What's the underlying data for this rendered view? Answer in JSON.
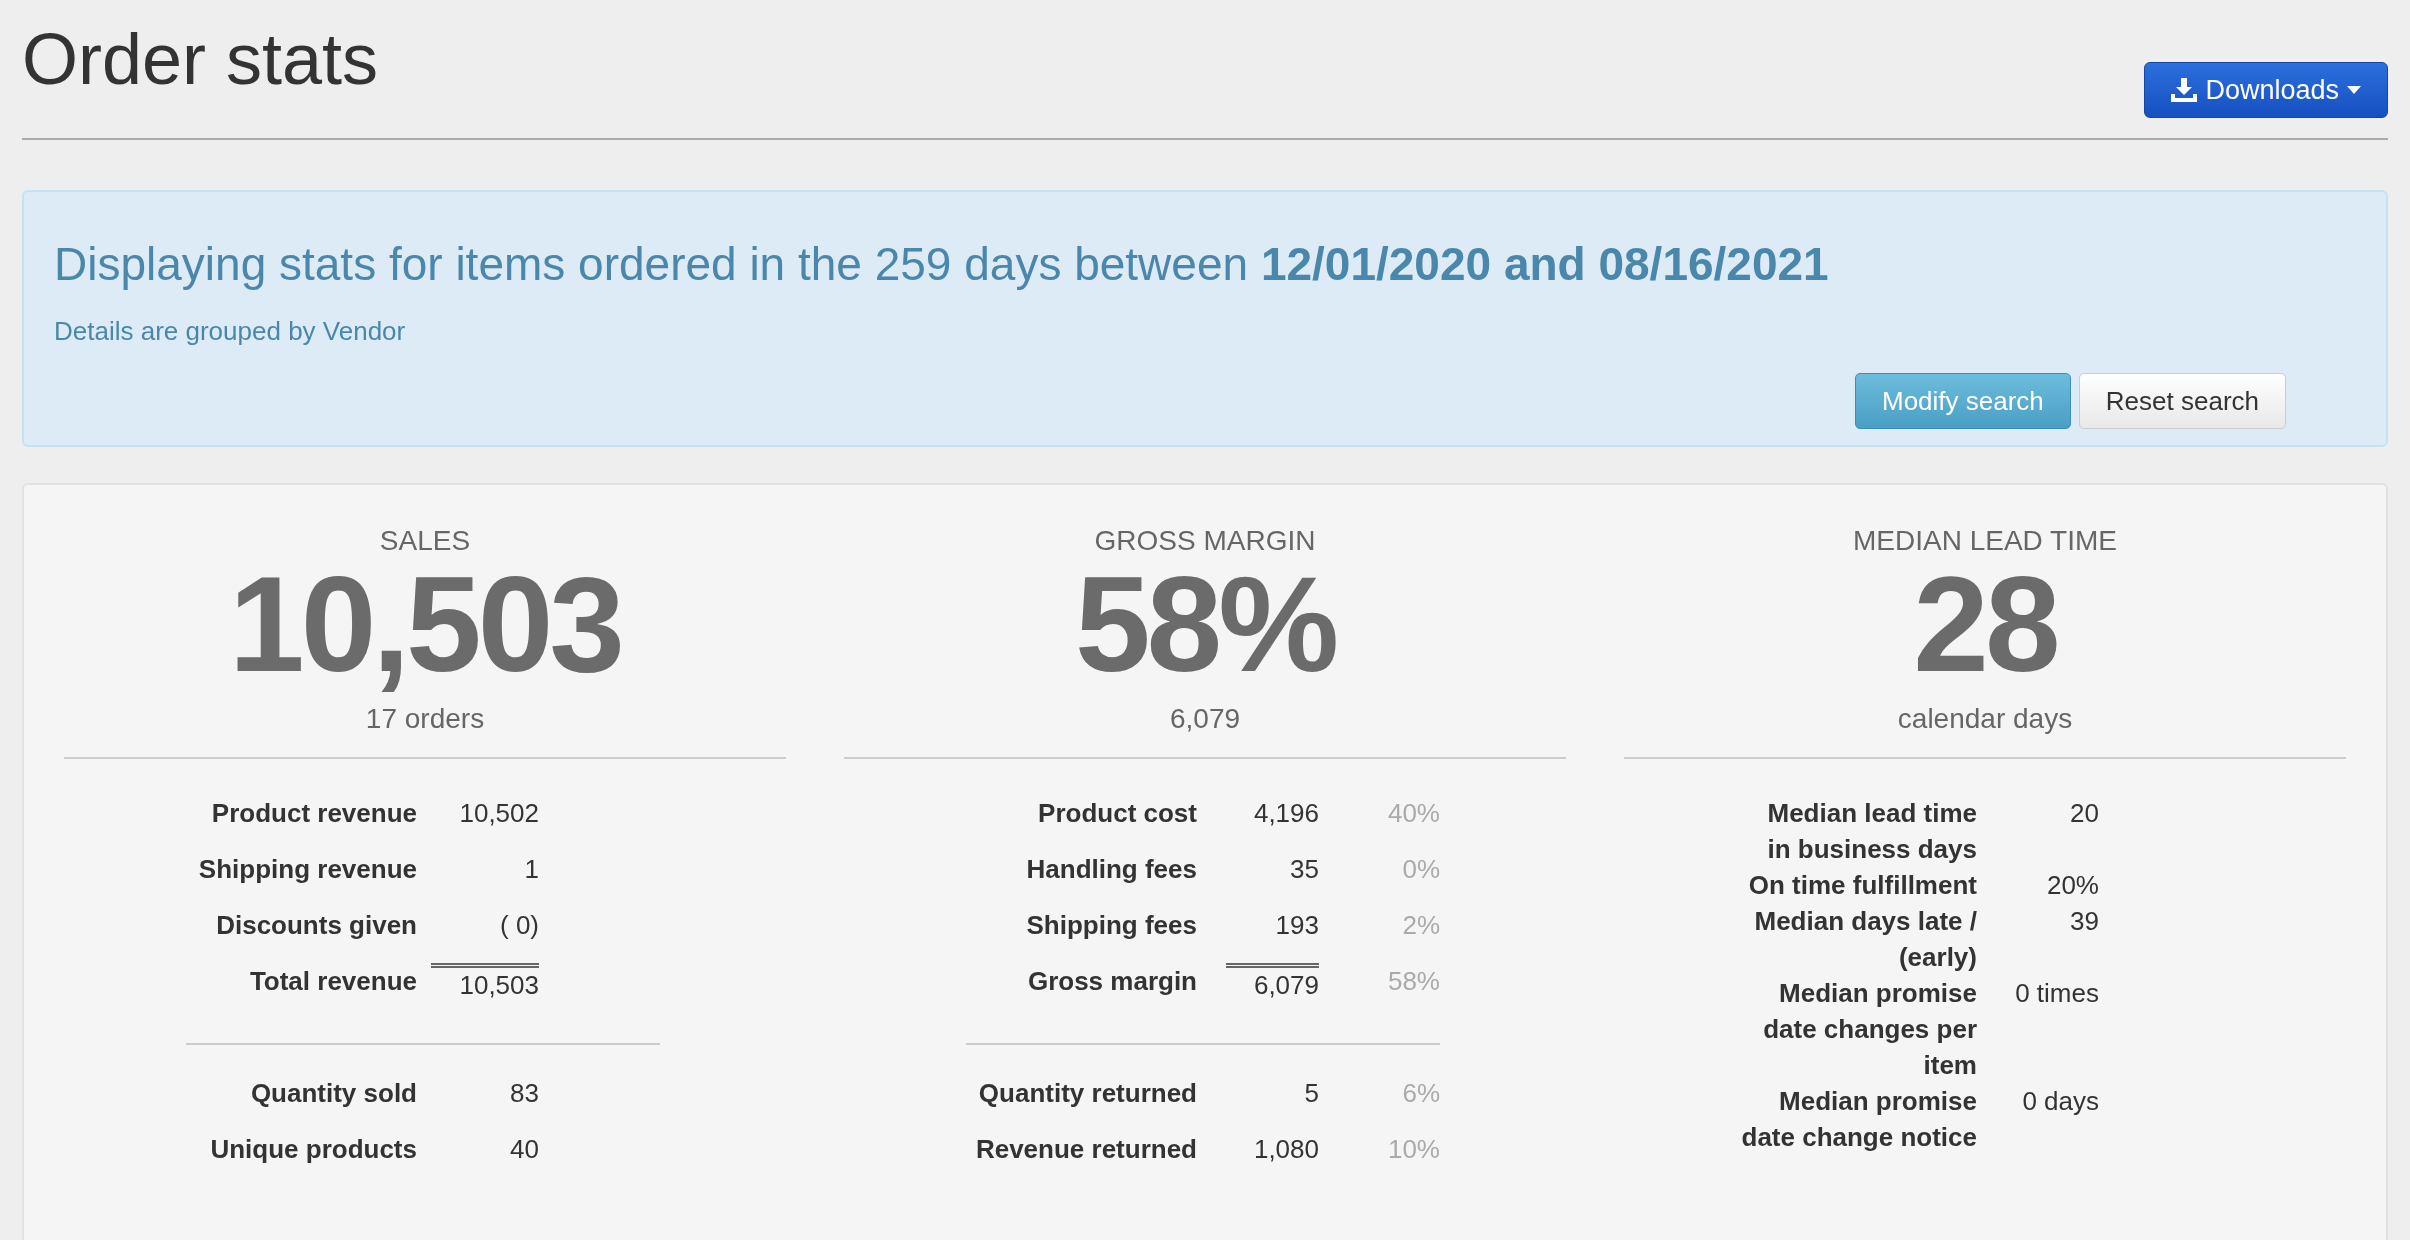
{
  "page_title": "Order stats",
  "downloads_button": {
    "label": "Downloads"
  },
  "info": {
    "heading": "Displaying stats for items ordered in the 259 days between **12/01/2020 and 08/16/2021**",
    "note": "Details are grouped by Vendor",
    "buttons": [
      {
        "label": "Modify search",
        "kind": "primary"
      },
      {
        "label": "Reset search",
        "kind": "default"
      }
    ]
  },
  "stats": [
    {
      "heading": "SALES",
      "value": "10,503",
      "subtext": "17 orders",
      "sections": [
        [
          {
            "label": "Product revenue",
            "value": "10,502",
            "kind": "normal"
          },
          {
            "label": "Shipping revenue",
            "value": "1",
            "kind": "normal"
          },
          {
            "label": "Discounts given",
            "value": "( 0)",
            "kind": "normal"
          },
          {
            "label": "Total revenue",
            "value": "10,503",
            "kind": "total"
          }
        ],
        [
          {
            "label": "Quantity sold",
            "value": "83",
            "kind": "normal"
          },
          {
            "label": "Unique products",
            "value": "40",
            "kind": "normal"
          }
        ]
      ]
    },
    {
      "heading": "GROSS MARGIN",
      "value": "58%",
      "subtext": "6,079",
      "sections": [
        [
          {
            "label": "Product cost",
            "value": "4,196",
            "percent": "40%",
            "kind": "normal"
          },
          {
            "label": "Handling fees",
            "value": "35",
            "percent": "0%",
            "kind": "normal"
          },
          {
            "label": "Shipping fees",
            "value": "193",
            "percent": "2%",
            "kind": "normal"
          },
          {
            "label": "Gross margin",
            "value": "6,079",
            "percent": "58%",
            "kind": "total"
          }
        ],
        [
          {
            "label": "Quantity returned",
            "value": "5",
            "percent": "6%",
            "kind": "normal"
          },
          {
            "label": "Revenue returned",
            "value": "1,080",
            "percent": "10%",
            "kind": "normal"
          }
        ]
      ]
    },
    {
      "heading": "MEDIAN LEAD TIME",
      "value": "28",
      "subtext": "calendar days",
      "sections": [
        [
          {
            "label": "Median lead time in business days",
            "value": "20",
            "kind": "wrapped"
          },
          {
            "label": "On time fulfillment",
            "value": "20%",
            "kind": "wrapped"
          },
          {
            "label": "Median days late / (early)",
            "value": "39",
            "kind": "wrapped"
          },
          {
            "label": "Median promise date changes per item",
            "value": "0 times",
            "kind": "wrapped"
          },
          {
            "label": "Median promise date change notice",
            "value": "0 days",
            "kind": "wrapped"
          }
        ]
      ]
    }
  ]
}
